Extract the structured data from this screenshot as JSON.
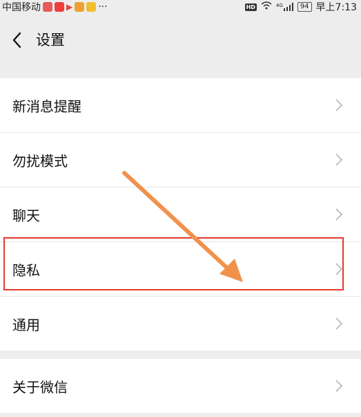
{
  "status_bar": {
    "carrier": "中国移动",
    "more": "···",
    "hd": "HD",
    "signal": "4G",
    "battery": "94",
    "time": "早上7:13"
  },
  "header": {
    "title": "设置"
  },
  "groups": [
    {
      "items": [
        {
          "label": "新消息提醒"
        },
        {
          "label": "勿扰模式"
        },
        {
          "label": "聊天"
        },
        {
          "label": "隐私"
        },
        {
          "label": "通用"
        }
      ]
    },
    {
      "items": [
        {
          "label": "关于微信"
        }
      ]
    }
  ],
  "colors": {
    "highlight": "#e23a2c",
    "arrow": "#f0924c",
    "background": "#ededed"
  }
}
